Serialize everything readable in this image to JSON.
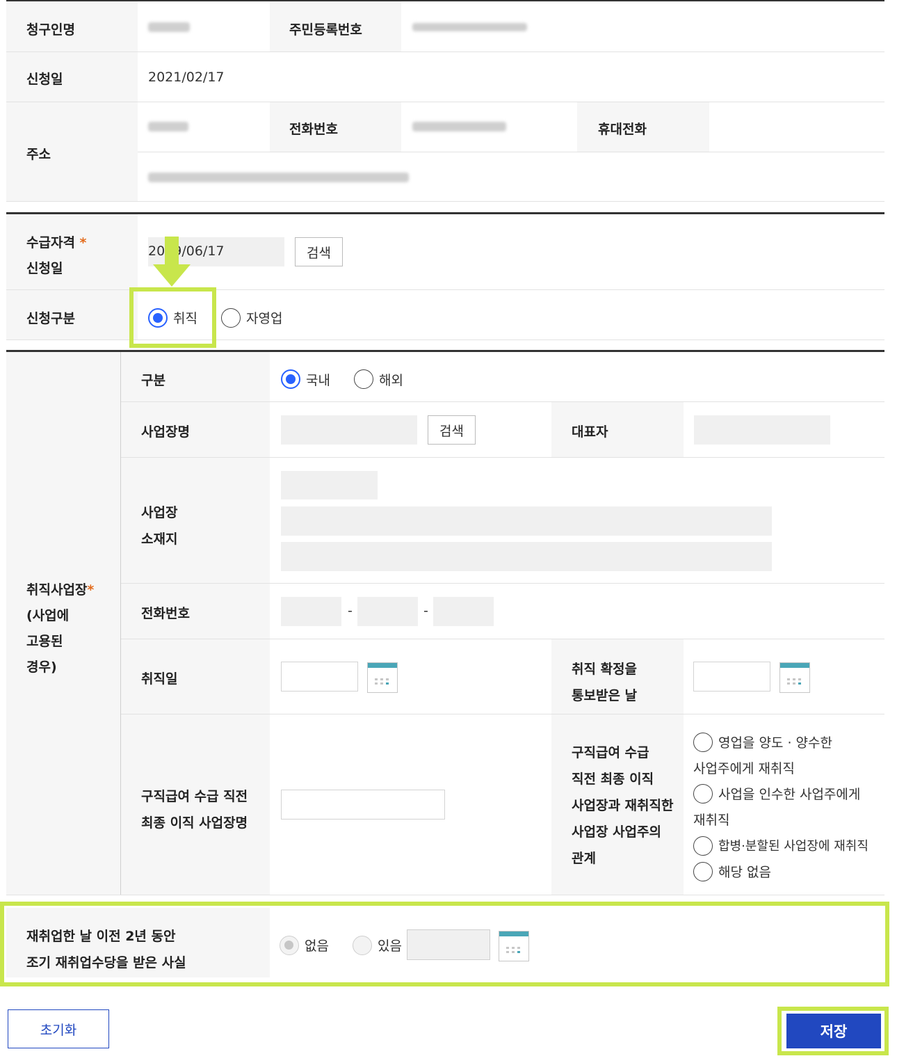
{
  "applicant": {
    "claimant_label": "청구인명",
    "rrn_label": "주민등록번호",
    "application_date_label": "신청일",
    "application_date_value": "2021/02/17",
    "address_label": "주소",
    "phone_label": "전화번호",
    "mobile_label": "휴대전화"
  },
  "eligibility": {
    "label_line1": "수급자격",
    "label_line2": "신청일",
    "required_mark": "*",
    "date_value": "2009/06/17",
    "search_button": "검색"
  },
  "application_type": {
    "label": "신청구분",
    "options": [
      {
        "label": "취직",
        "checked": true
      },
      {
        "label": "자영업",
        "checked": false
      }
    ]
  },
  "workplace": {
    "section_label_line1": "취직사업장",
    "required_mark": "*",
    "section_label_line2": "(사업에",
    "section_label_line3": "고용된",
    "section_label_line4": "경우)",
    "division_label": "구분",
    "division_options": [
      {
        "label": "국내",
        "checked": true
      },
      {
        "label": "해외",
        "checked": false
      }
    ],
    "name_label": "사업장명",
    "search_button": "검색",
    "representative_label": "대표자",
    "location_label_line1": "사업장",
    "location_label_line2": "소재지",
    "phone_label": "전화번호",
    "phone_sep": "-",
    "hire_date_label": "취직일",
    "confirm_date_label_line1": "취직 확정을",
    "confirm_date_label_line2": "통보받은 날",
    "prev_workplace_label_line1": "구직급여 수급 직전",
    "prev_workplace_label_line2": "최종 이직 사업장명",
    "relation_label_lines": [
      "구직급여 수급",
      "직전 최종 이직",
      "사업장과 재취직한",
      "사업장 사업주의",
      "관계"
    ],
    "relation_options": [
      {
        "label_line1": "영업을 양도 · 양수한",
        "label_line2": "사업주에게 재취직"
      },
      {
        "label_line1": "사업을 인수한 사업주에게",
        "label_line2": "재취직"
      },
      {
        "label_line1": "합병·분할된 사업장에 재취직",
        "label_line2": ""
      },
      {
        "label_line1": "해당 없음",
        "label_line2": ""
      }
    ]
  },
  "early_benefit": {
    "label_line1": "재취업한 날 이전 2년 동안",
    "label_line2": "조기 재취업수당을 받은 사실",
    "options": [
      {
        "label": "없음",
        "checked": true
      },
      {
        "label": "있음",
        "checked": false
      }
    ]
  },
  "actions": {
    "reset": "초기화",
    "save": "저장"
  },
  "colors": {
    "accent_blue": "#2962ff",
    "save_button": "#2148c0",
    "highlight": "#c8e64c",
    "required": "#e36b1c"
  }
}
